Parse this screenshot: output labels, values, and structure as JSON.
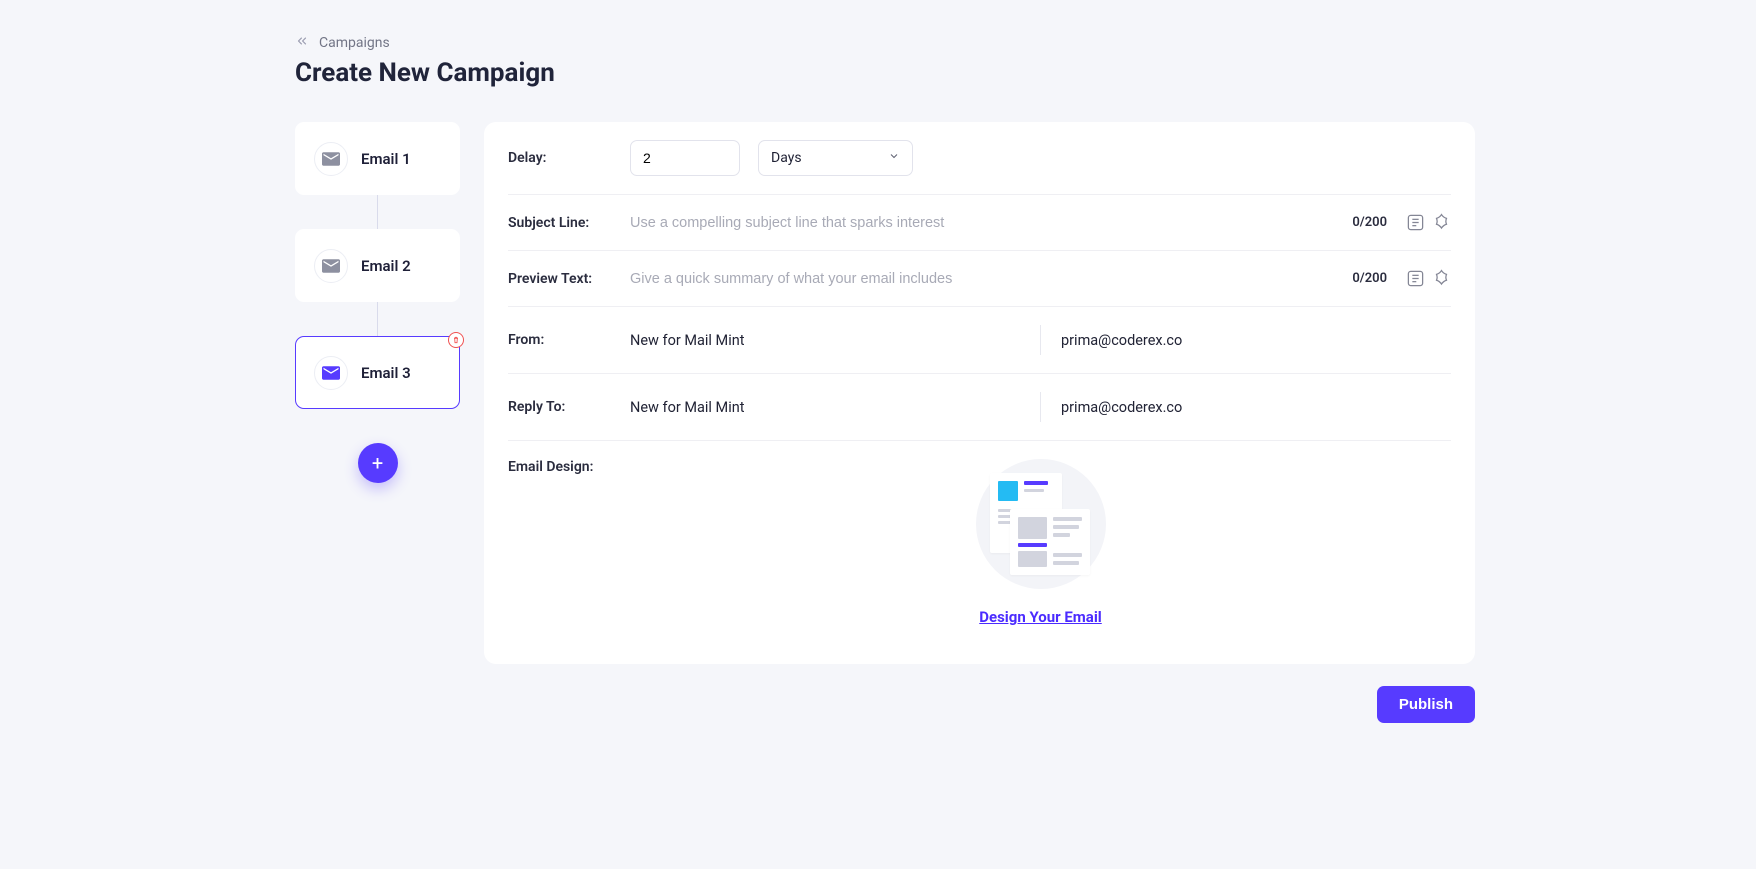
{
  "breadcrumb": {
    "back_label": "Campaigns"
  },
  "page_title": "Create New Campaign",
  "steps": {
    "items": [
      {
        "label": "Email 1"
      },
      {
        "label": "Email 2"
      },
      {
        "label": "Email 3"
      }
    ]
  },
  "form": {
    "delay": {
      "label": "Delay:",
      "value": "2",
      "unit": "Days"
    },
    "subject": {
      "label": "Subject Line:",
      "placeholder": "Use a compelling subject line that sparks interest",
      "count": "0/200"
    },
    "preview": {
      "label": "Preview Text:",
      "placeholder": "Give a quick summary of what your email includes",
      "count": "0/200"
    },
    "from": {
      "label": "From:",
      "name": "New for Mail Mint",
      "email": "prima@coderex.co"
    },
    "reply_to": {
      "label": "Reply To:",
      "name": "New for Mail Mint",
      "email": "prima@coderex.co"
    },
    "design": {
      "label": "Email Design:",
      "link": "Design Your Email"
    }
  },
  "actions": {
    "publish": "Publish"
  }
}
